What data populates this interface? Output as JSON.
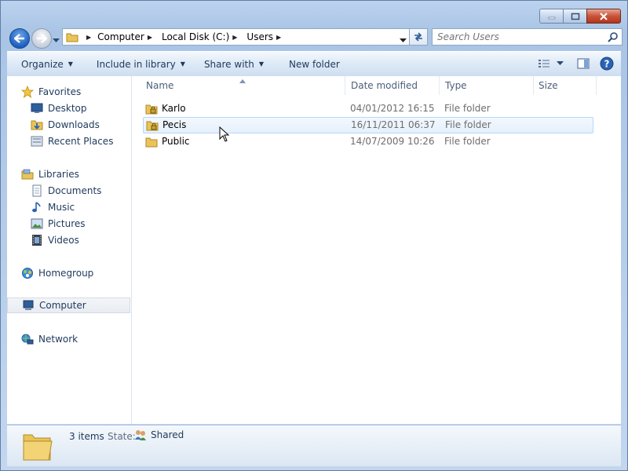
{
  "window": {
    "buttons": [
      "minimize",
      "maximize",
      "close"
    ]
  },
  "address": {
    "crumbs": [
      "Computer",
      "Local Disk (C:)",
      "Users"
    ]
  },
  "search": {
    "placeholder": "Search Users"
  },
  "toolbar": {
    "organize": "Organize",
    "include": "Include in library",
    "share": "Share with",
    "new_folder": "New folder"
  },
  "nav": {
    "favorites": "Favorites",
    "desktop": "Desktop",
    "downloads": "Downloads",
    "recent": "Recent Places",
    "libraries": "Libraries",
    "documents": "Documents",
    "music": "Music",
    "pictures": "Pictures",
    "videos": "Videos",
    "homegroup": "Homegroup",
    "computer": "Computer",
    "network": "Network"
  },
  "columns": {
    "name": "Name",
    "date": "Date modified",
    "type": "Type",
    "size": "Size"
  },
  "files": [
    {
      "name": "Karlo",
      "date": "04/01/2012 16:15",
      "type": "File folder",
      "locked": true
    },
    {
      "name": "Pecis",
      "date": "16/11/2011 06:37",
      "type": "File folder",
      "locked": true
    },
    {
      "name": "Public",
      "date": "14/07/2009 10:26",
      "type": "File folder",
      "locked": false
    }
  ],
  "status": {
    "count": "3 items",
    "state_label": "State:",
    "state_value": "Shared"
  },
  "colors": {
    "accent": "#1e395b",
    "hover_border": "#b8d6fb",
    "folder": "#e8c45a"
  }
}
